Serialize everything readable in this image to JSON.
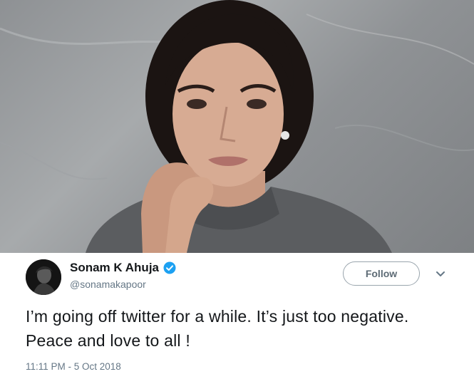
{
  "photo": {
    "icon": "portrait-photo"
  },
  "tweet": {
    "display_name": "Sonam K Ahuja",
    "verified_icon": "verified-badge-icon",
    "handle": "@sonamakapoor",
    "follow_label": "Follow",
    "menu_icon": "chevron-down-icon",
    "text": "I’m going off twitter for a while. It’s just too negative. Peace and love to all !",
    "timestamp": "11:11 PM - 5 Oct 2018",
    "colors": {
      "verified": "#1da1f2",
      "name": "#14171a",
      "secondary": "#657786"
    }
  }
}
